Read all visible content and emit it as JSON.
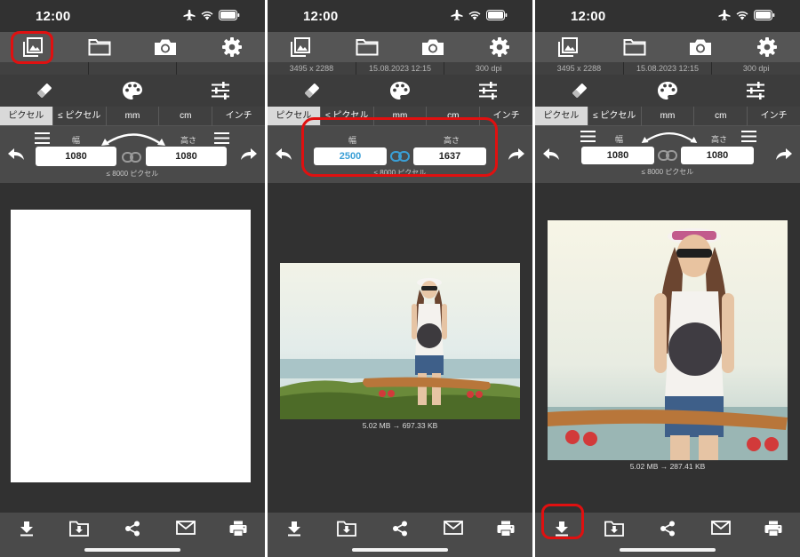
{
  "status": {
    "time": "12:00"
  },
  "icons": {
    "toolbar": [
      "gallery-icon",
      "folder-icon",
      "camera-icon",
      "gear-icon"
    ],
    "tools": [
      "eraser-icon",
      "palette-icon",
      "sliders-icon"
    ],
    "bottom": [
      "download-icon",
      "save-to-folder-icon",
      "share-icon",
      "mail-icon",
      "print-icon"
    ]
  },
  "units": [
    "ピクセル",
    "≤ ピクセル",
    "mm",
    "cm",
    "インチ"
  ],
  "labels": {
    "width": "幅",
    "height": "高さ",
    "limit": "≤ 8000 ピクセル"
  },
  "screens": [
    {
      "info": {
        "dimensions": "",
        "date": "",
        "dpi": ""
      },
      "width": "1080",
      "height": "1080",
      "caption": ""
    },
    {
      "info": {
        "dimensions": "3495 x 2288",
        "date": "15.08.2023 12:15",
        "dpi": "300 dpi"
      },
      "width": "2500",
      "height": "1637",
      "caption": "5.02 MB  →  697.33 KB"
    },
    {
      "info": {
        "dimensions": "3495 x 2288",
        "date": "15.08.2023 12:15",
        "dpi": "300 dpi"
      },
      "width": "1080",
      "height": "1080",
      "caption": "5.02 MB  →  287.41 KB"
    }
  ],
  "colors": {
    "highlight": "#e01010",
    "accent": "#3a9fd6",
    "toolbar": "#555555",
    "background": "#313131"
  }
}
